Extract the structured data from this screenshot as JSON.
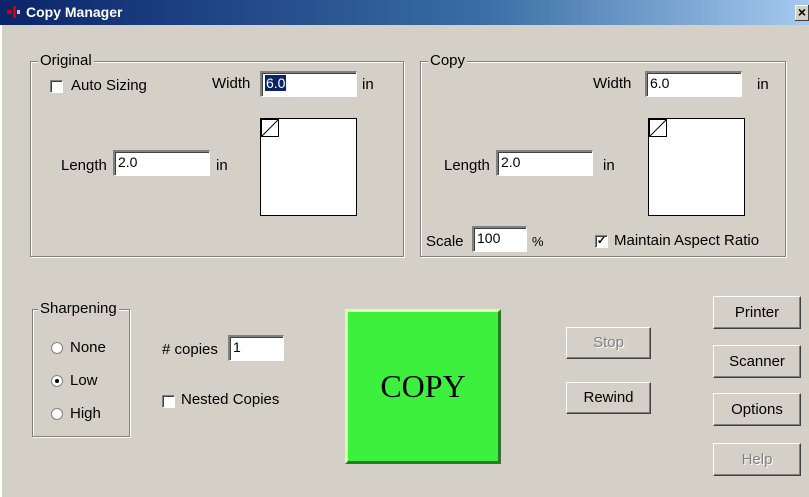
{
  "window": {
    "title": "Copy Manager",
    "close_glyph": "×"
  },
  "original": {
    "legend": "Original",
    "auto_sizing_label": "Auto Sizing",
    "auto_sizing_checked": false,
    "width_label": "Width",
    "width_value": "6.0",
    "width_unit": "in",
    "length_label": "Length",
    "length_value": "2.0",
    "length_unit": "in"
  },
  "copy": {
    "legend": "Copy",
    "width_label": "Width",
    "width_value": "6.0",
    "width_unit": "in",
    "length_label": "Length",
    "length_value": "2.0",
    "length_unit": "in",
    "scale_label": "Scale",
    "scale_value": "100",
    "scale_unit": "%",
    "maintain_aspect_label": "Maintain Aspect Ratio",
    "maintain_aspect_checked": true
  },
  "sharpening": {
    "legend": "Sharpening",
    "options": [
      "None",
      "Low",
      "High"
    ],
    "selected": "Low"
  },
  "copies": {
    "label": "# copies",
    "value": "1",
    "nested_label": "Nested Copies",
    "nested_checked": false
  },
  "buttons": {
    "copy": "COPY",
    "stop": "Stop",
    "rewind": "Rewind",
    "printer": "Printer",
    "scanner": "Scanner",
    "options": "Options",
    "help": "Help"
  },
  "colors": {
    "copy_button": "#3ef03e",
    "title_bar": "#0a246a",
    "dialog_face": "#d4d0c8"
  }
}
